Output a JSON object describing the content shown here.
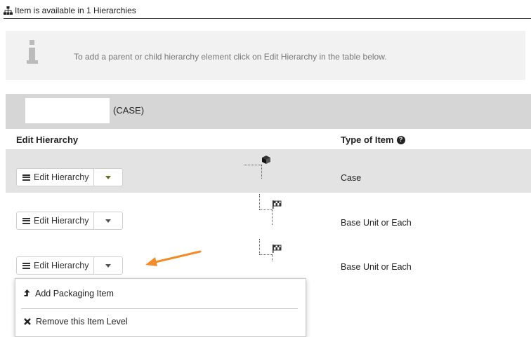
{
  "header": {
    "text": "Item is available in 1 Hierarchies",
    "icon": "sitemap-icon"
  },
  "info": {
    "text": "To add a parent or child hierarchy element click on Edit Hierarchy in the table below.",
    "icon": "info-icon"
  },
  "case_bar": {
    "label": "(CASE)"
  },
  "table": {
    "headers": {
      "edit": "Edit Hierarchy",
      "type": "Type of Item"
    },
    "rows": [
      {
        "button_label": "Edit Hierarchy",
        "type": "Case",
        "tree_icon": "cube-icon"
      },
      {
        "button_label": "Edit Hierarchy",
        "type": "Base Unit or Each",
        "tree_icon": "checkered-flag-icon"
      },
      {
        "button_label": "Edit Hierarchy",
        "type": "Base Unit or Each",
        "tree_icon": "checkered-flag-icon"
      }
    ]
  },
  "dropdown_menu": {
    "items": [
      {
        "label": "Add Packaging Item",
        "icon": "level-up-icon"
      },
      {
        "label": "Remove this Item Level",
        "icon": "times-icon"
      }
    ]
  },
  "colors": {
    "arrow": "#f28c28",
    "selected_row": "#e3e3e3",
    "case_bar": "#d6d6d6",
    "info_bg": "#f2f2f2"
  }
}
